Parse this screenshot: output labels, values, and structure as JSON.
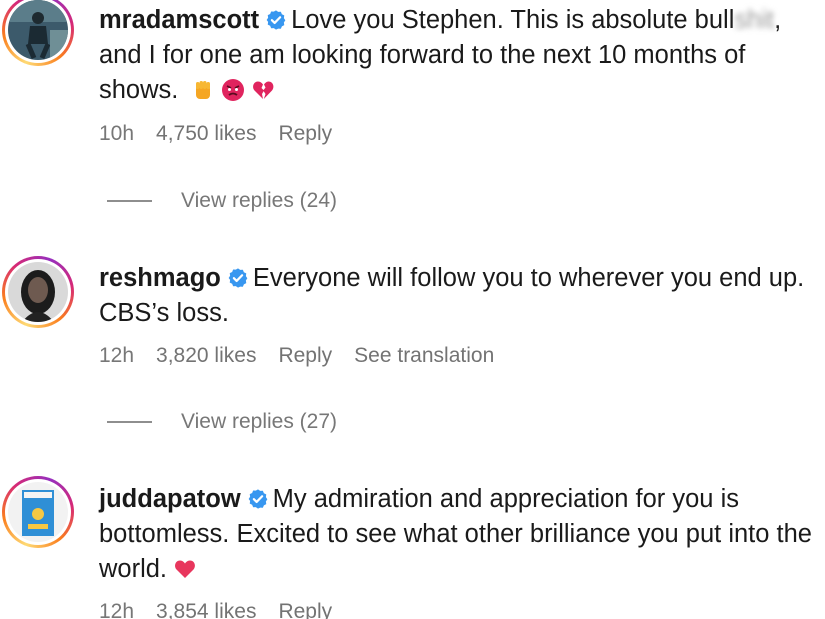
{
  "comments": [
    {
      "username": "mradamscott",
      "text_start": "Love you Stephen. This is absolute bull",
      "text_blurred": "shit",
      "text_end": ", and I for one am looking forward to the next 10 months of shows.",
      "emojis": [
        "raised-fist-emoji",
        "angry-face-emoji",
        "broken-heart-emoji"
      ],
      "time": "10h",
      "likes": "4,750 likes",
      "reply": "Reply",
      "view_replies": "View replies (24)"
    },
    {
      "username": "reshmago",
      "text": "Everyone will follow you to wherever you end up. CBS’s loss.",
      "time": "12h",
      "likes": "3,820 likes",
      "reply": "Reply",
      "see_translation": "See translation",
      "view_replies": "View replies (27)"
    },
    {
      "username": "juddapatow",
      "text": "My admiration and appreciation for you is bottomless. Excited to see what other brilliance you put into the world.",
      "emojis": [
        "heart-emoji"
      ],
      "time": "12h",
      "likes": "3,854 likes",
      "reply": "Reply"
    }
  ],
  "colors": {
    "verified": "#3897f0",
    "meta_text": "#777777",
    "ring_gradient": [
      "#feda75",
      "#fa7e1e",
      "#d62976",
      "#962fbf"
    ]
  }
}
